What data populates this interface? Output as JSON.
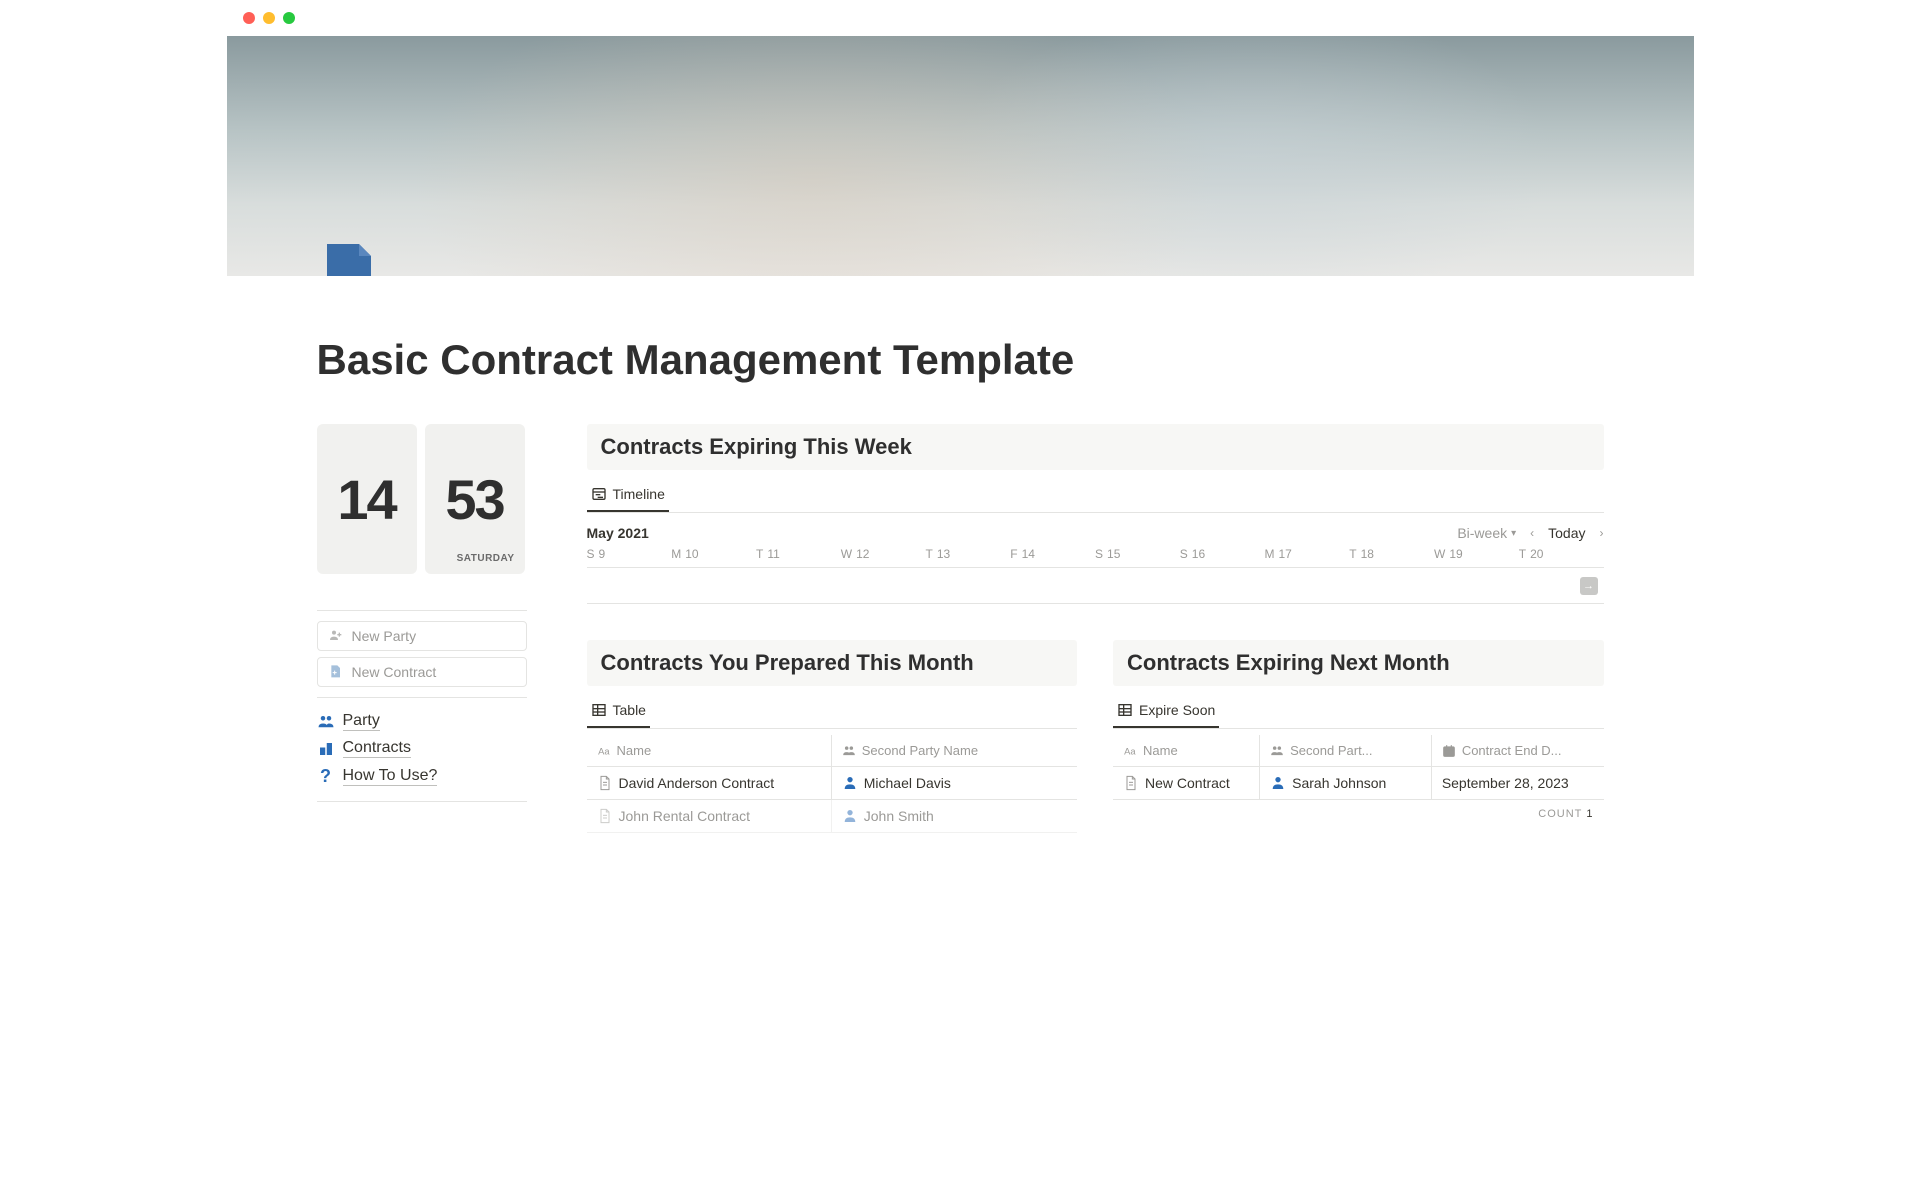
{
  "page": {
    "title": "Basic Contract Management Template"
  },
  "clock": {
    "hour": "14",
    "minute": "53",
    "day": "SATURDAY"
  },
  "sidebar": {
    "new_party": "New Party",
    "new_contract": "New Contract",
    "links": {
      "party": "Party",
      "contracts": "Contracts",
      "howto": "How To Use?"
    }
  },
  "sections": {
    "expiring_week": {
      "title": "Contracts Expiring This Week",
      "view_tab": "Timeline",
      "month": "May 2021",
      "scale": "Bi-week",
      "today": "Today",
      "days": [
        {
          "dow": "S",
          "num": "9"
        },
        {
          "dow": "M",
          "num": "10"
        },
        {
          "dow": "T",
          "num": "11"
        },
        {
          "dow": "W",
          "num": "12"
        },
        {
          "dow": "T",
          "num": "13"
        },
        {
          "dow": "F",
          "num": "14"
        },
        {
          "dow": "S",
          "num": "15"
        },
        {
          "dow": "S",
          "num": "16"
        },
        {
          "dow": "M",
          "num": "17"
        },
        {
          "dow": "T",
          "num": "18"
        },
        {
          "dow": "W",
          "num": "19"
        },
        {
          "dow": "T",
          "num": "20"
        }
      ]
    },
    "prepared_month": {
      "title": "Contracts You Prepared This Month",
      "view_tab": "Table",
      "cols": {
        "name": "Name",
        "party": "Second Party Name"
      },
      "rows": [
        {
          "name": "David Anderson Contract",
          "party": "Michael Davis"
        },
        {
          "name": "John Rental Contract",
          "party": "John Smith"
        }
      ]
    },
    "expiring_next": {
      "title": "Contracts Expiring Next Month",
      "view_tab": "Expire Soon",
      "cols": {
        "name": "Name",
        "party": "Second Part...",
        "date": "Contract End D..."
      },
      "rows": [
        {
          "name": "New Contract",
          "party": "Sarah Johnson",
          "date": "September 28, 2023"
        }
      ],
      "count_label": "COUNT",
      "count": "1"
    }
  }
}
